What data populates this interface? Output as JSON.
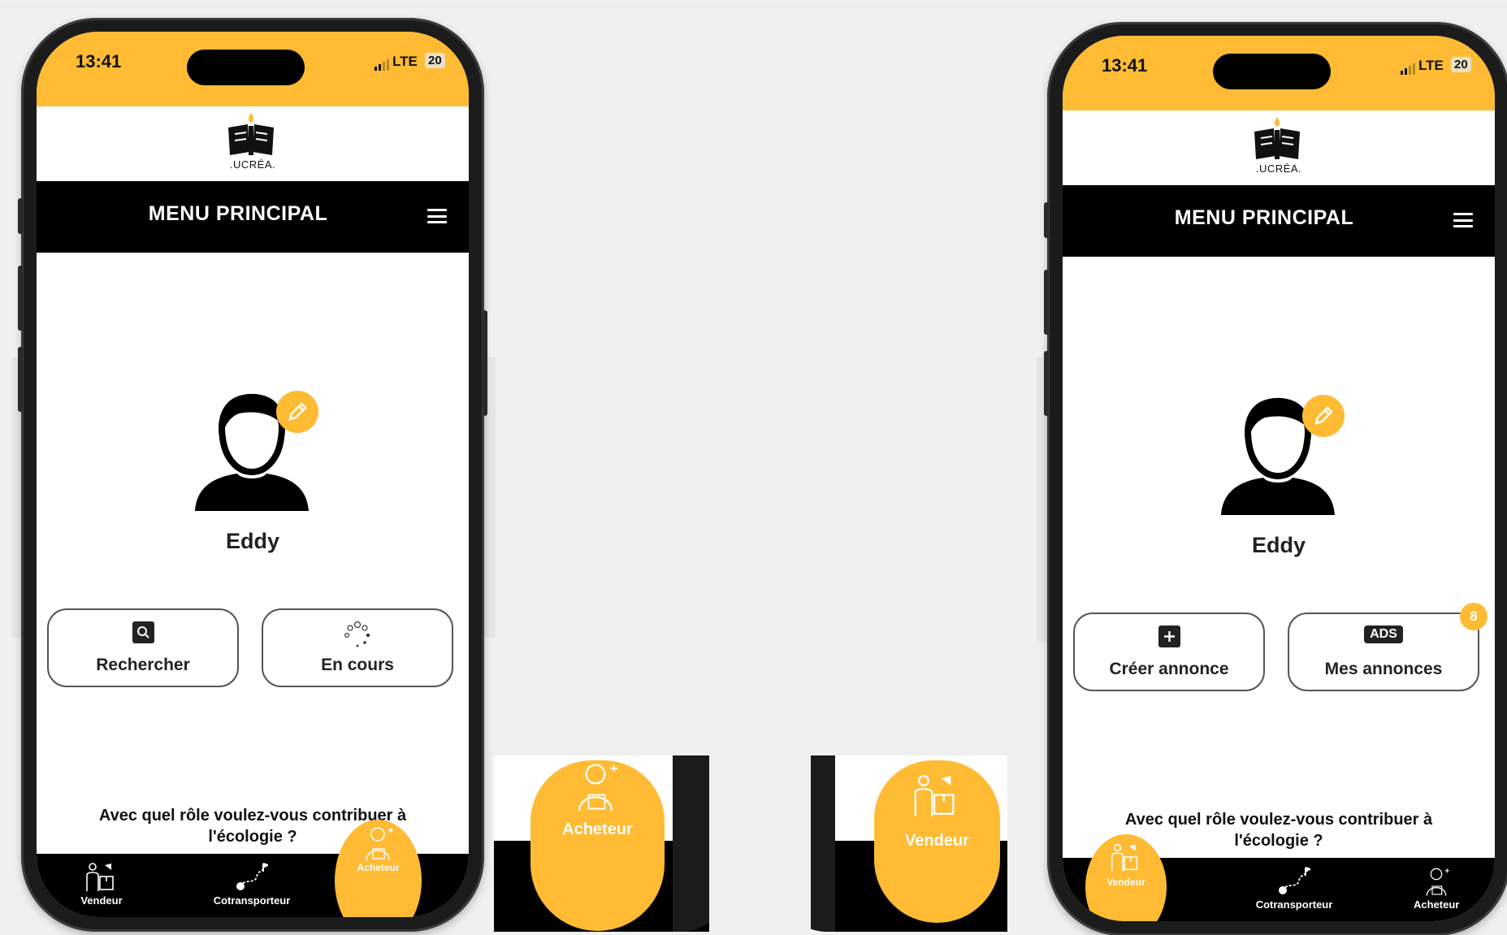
{
  "colors": {
    "accent": "#ffbb33",
    "bar": "#000000",
    "text": "#222222"
  },
  "status": {
    "time": "13:41",
    "network": "LTE",
    "battery": "20"
  },
  "logo": {
    "text": ".UCRÉA.",
    "icon": "ucrea-logo"
  },
  "screens": [
    {
      "menu_title": "MENU PRINCIPAL",
      "user": {
        "name": "Eddy"
      },
      "buttons": [
        {
          "label": "Rechercher",
          "icon": "search-icon"
        },
        {
          "label": "En cours",
          "icon": "loading-icon"
        }
      ],
      "question": "Avec quel rôle voulez-vous contribuer à l'écologie ?",
      "nav": [
        {
          "label": "Vendeur",
          "icon": "seller-icon"
        },
        {
          "label": "Cotransporteur",
          "icon": "route-icon"
        },
        {
          "label": "Acheteur",
          "icon": "buyer-icon",
          "active": true
        }
      ]
    },
    {
      "menu_title": "MENU PRINCIPAL",
      "user": {
        "name": "Eddy"
      },
      "buttons": [
        {
          "label": "Créer annonce",
          "icon": "plus-icon"
        },
        {
          "label": "Mes annonces",
          "icon": "ads-icon",
          "tag": "ADS",
          "badge": "8"
        }
      ],
      "question": "Avec quel rôle voulez-vous contribuer à l'écologie ?",
      "nav": [
        {
          "label": "Vendeur",
          "icon": "seller-icon",
          "active": true
        },
        {
          "label": "Cotransporteur",
          "icon": "route-icon"
        },
        {
          "label": "Acheteur",
          "icon": "buyer-icon"
        }
      ]
    }
  ],
  "zooms": [
    {
      "label": "Acheteur",
      "icon": "buyer-icon"
    },
    {
      "label": "Vendeur",
      "icon": "seller-icon"
    }
  ]
}
